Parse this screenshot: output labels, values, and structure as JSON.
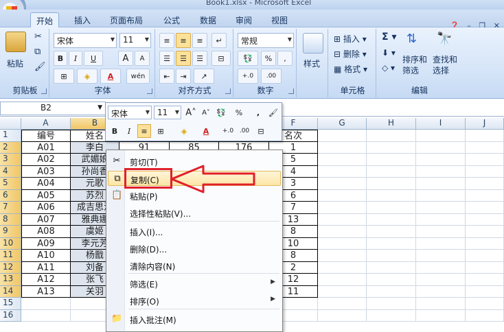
{
  "window": {
    "title": "Book1.xlsx - Microsoft Excel"
  },
  "tabs": [
    {
      "label": "开始",
      "active": true
    },
    {
      "label": "插入"
    },
    {
      "label": "页面布局"
    },
    {
      "label": "公式"
    },
    {
      "label": "数据"
    },
    {
      "label": "审阅"
    },
    {
      "label": "视图"
    }
  ],
  "ribbon": {
    "clipboard": {
      "label": "剪贴板",
      "paste": "粘贴"
    },
    "font": {
      "label": "字体",
      "name": "宋体",
      "size": "11",
      "bold": "B",
      "italic": "I",
      "underline": "U",
      "grow": "A",
      "shrink": "A",
      "phonetic": "wén"
    },
    "alignment": {
      "label": "对齐方式"
    },
    "number": {
      "label": "数字",
      "format": "常规",
      "percent": "%",
      "comma": ","
    },
    "styles": {
      "label": "样式",
      "btn": "样式"
    },
    "cells": {
      "label": "单元格",
      "insert": "插入",
      "delete": "删除",
      "format": "格式"
    },
    "editing": {
      "label": "编辑",
      "sort": "排序和",
      "sort2": "筛选",
      "find": "查找和",
      "find2": "选择"
    }
  },
  "formula_bar": {
    "name_box": "B2"
  },
  "columns": [
    "A",
    "B",
    "C",
    "D",
    "E",
    "F",
    "G",
    "H",
    "I",
    "J"
  ],
  "rows": [
    "1",
    "2",
    "3",
    "4",
    "5",
    "6",
    "7",
    "8",
    "9",
    "10",
    "11",
    "12",
    "13",
    "14",
    "15",
    "16"
  ],
  "sheet": {
    "header": {
      "A": "编号",
      "B": "姓名",
      "F": "名次"
    },
    "data": [
      {
        "A": "A01",
        "B": "李白",
        "C": "91",
        "D": "85",
        "E": "176",
        "F": "1"
      },
      {
        "A": "A02",
        "B": "武媚娘",
        "F": "5"
      },
      {
        "A": "A03",
        "B": "孙尚香",
        "F": "4"
      },
      {
        "A": "A04",
        "B": "元歌",
        "F": "3"
      },
      {
        "A": "A05",
        "B": "苏烈",
        "F": "6"
      },
      {
        "A": "A06",
        "B": "成吉思汗",
        "F": "7"
      },
      {
        "A": "A07",
        "B": "雅典娜",
        "F": "13"
      },
      {
        "A": "A08",
        "B": "虞姬",
        "F": "8"
      },
      {
        "A": "A09",
        "B": "李元芳",
        "F": "10"
      },
      {
        "A": "A10",
        "B": "杨戬",
        "F": "8"
      },
      {
        "A": "A11",
        "B": "刘备",
        "F": "2"
      },
      {
        "A": "A12",
        "B": "张飞",
        "F": "12"
      },
      {
        "A": "A13",
        "B": "关羽",
        "F": "11"
      }
    ]
  },
  "mini_toolbar": {
    "font": "宋体",
    "size": "11",
    "bold": "B",
    "italic": "I",
    "percent": "%",
    "comma": ","
  },
  "context_menu": [
    {
      "label": "剪切(T)",
      "icon": "scissors-icon"
    },
    {
      "label": "复制(C)",
      "icon": "copy-icon",
      "highlighted": true
    },
    {
      "label": "粘贴(P)",
      "icon": "paste-icon"
    },
    {
      "label": "选择性粘贴(V)..."
    },
    {
      "label": "插入(I)..."
    },
    {
      "label": "删除(D)..."
    },
    {
      "label": "清除内容(N)"
    },
    {
      "label": "筛选(E)",
      "submenu": true
    },
    {
      "label": "排序(O)",
      "submenu": true
    },
    {
      "label": "插入批注(M)",
      "icon": "comment-icon"
    }
  ],
  "colors": {
    "accent": "#e0202b",
    "selection": "#fce19a"
  }
}
